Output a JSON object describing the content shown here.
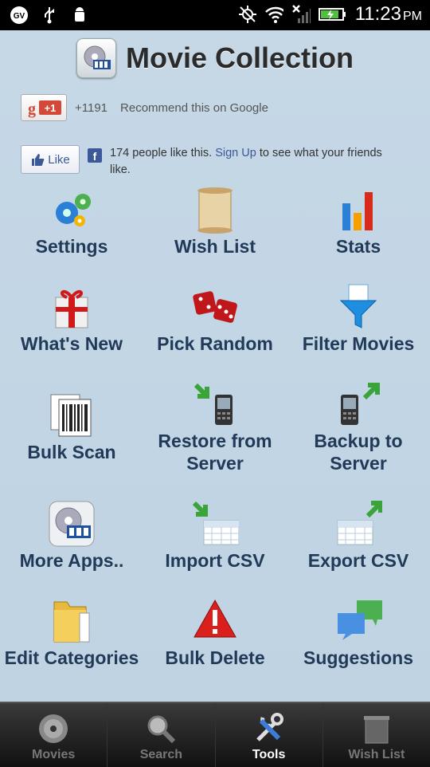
{
  "status_bar": {
    "time": "11:23",
    "ampm": "PM",
    "left_icons": [
      "gv-icon",
      "usb-icon",
      "android-debug-icon"
    ],
    "right_icons": [
      "gps-off-icon",
      "wifi-icon",
      "signal-icon",
      "battery-icon"
    ]
  },
  "header": {
    "title": "Movie Collection"
  },
  "google_plus": {
    "button_label": "+1",
    "count": "+1191",
    "text": "Recommend this on Google"
  },
  "facebook": {
    "like_label": "Like",
    "text_prefix": "174 people like this.",
    "link_text": "Sign Up",
    "text_suffix": "to see what your friends like."
  },
  "tools": [
    {
      "label": "Settings",
      "icon": "gears-icon"
    },
    {
      "label": "Wish List",
      "icon": "scroll-icon"
    },
    {
      "label": "Stats",
      "icon": "bar-chart-icon"
    },
    {
      "label": "What's New",
      "icon": "gift-icon"
    },
    {
      "label": "Pick Random",
      "icon": "dice-icon"
    },
    {
      "label": "Filter Movies",
      "icon": "funnel-icon"
    },
    {
      "label": "Bulk Scan",
      "icon": "barcode-icon"
    },
    {
      "label": "Restore from Server",
      "icon": "phone-download-icon"
    },
    {
      "label": "Backup to Server",
      "icon": "phone-upload-icon"
    },
    {
      "label": "More Apps..",
      "icon": "app-logo-icon"
    },
    {
      "label": "Import CSV",
      "icon": "table-import-icon"
    },
    {
      "label": "Export CSV",
      "icon": "table-export-icon"
    },
    {
      "label": "Edit Categories",
      "icon": "folder-icon"
    },
    {
      "label": "Bulk Delete",
      "icon": "warning-icon"
    },
    {
      "label": "Suggestions",
      "icon": "chat-bubbles-icon"
    }
  ],
  "tabs": [
    {
      "label": "Movies",
      "icon": "disc-icon",
      "active": false
    },
    {
      "label": "Search",
      "icon": "magnifier-icon",
      "active": false
    },
    {
      "label": "Tools",
      "icon": "tools-icon",
      "active": true
    },
    {
      "label": "Wish List",
      "icon": "trash-list-icon",
      "active": false
    }
  ]
}
